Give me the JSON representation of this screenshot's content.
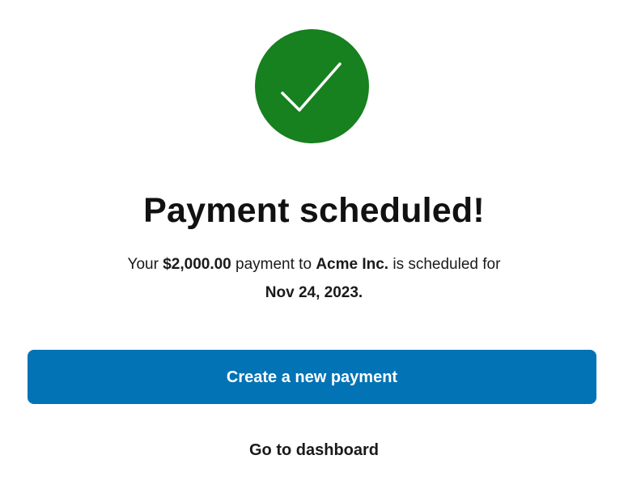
{
  "status": {
    "icon": "check-icon",
    "color": "#17801f"
  },
  "title": "Payment scheduled!",
  "message": {
    "prefix": "Your ",
    "amount": "$2,000.00",
    "middle": " payment to ",
    "payee": "Acme Inc.",
    "suffix": " is scheduled for",
    "date": "Nov 24, 2023."
  },
  "actions": {
    "primary_label": "Create a new payment",
    "primary_color": "#0273b5",
    "secondary_label": "Go to dashboard"
  }
}
